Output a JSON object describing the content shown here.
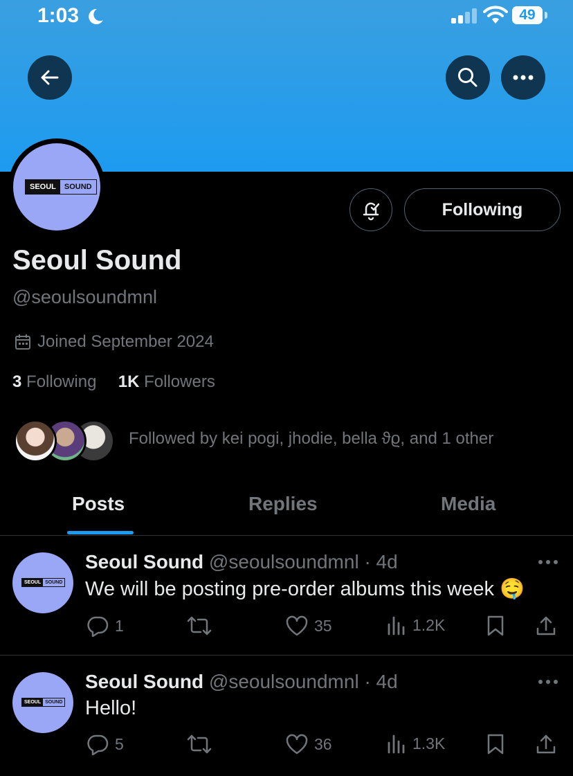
{
  "status_bar": {
    "time": "1:03",
    "battery": "49"
  },
  "profile": {
    "logo_left": "SEOUL",
    "logo_right": "SOUND",
    "name": "Seoul Sound",
    "handle": "@seoulsoundmnl",
    "joined": "Joined September 2024",
    "following_count": "3",
    "following_label": "Following",
    "followers_count": "1K",
    "followers_label": "Followers",
    "followed_by": "Followed by kei pogi, jhodie, bella ϑϱ, and 1 other",
    "follow_button": "Following"
  },
  "tabs": [
    {
      "label": "Posts",
      "active": true
    },
    {
      "label": "Replies",
      "active": false
    },
    {
      "label": "Media",
      "active": false
    }
  ],
  "posts": [
    {
      "name": "Seoul Sound",
      "meta": "@seoulsoundmnl · 4d",
      "text": "We will be posting pre-order albums this week 🤤",
      "replies": "1",
      "reposts": "",
      "likes": "35",
      "views": "1.2K"
    },
    {
      "name": "Seoul Sound",
      "meta": "@seoulsoundmnl · 4d",
      "text": "Hello!",
      "replies": "5",
      "reposts": "",
      "likes": "36",
      "views": "1.3K"
    }
  ],
  "colors": {
    "accent": "#1d9bf0",
    "background": "#000000",
    "avatar": "#9aa7f7",
    "muted_text": "#71767b"
  },
  "icons": [
    "back-arrow-icon",
    "search-icon",
    "more-icon",
    "bell-icon",
    "calendar-icon",
    "reply-icon",
    "repost-icon",
    "like-icon",
    "views-icon",
    "bookmark-icon",
    "share-icon"
  ]
}
